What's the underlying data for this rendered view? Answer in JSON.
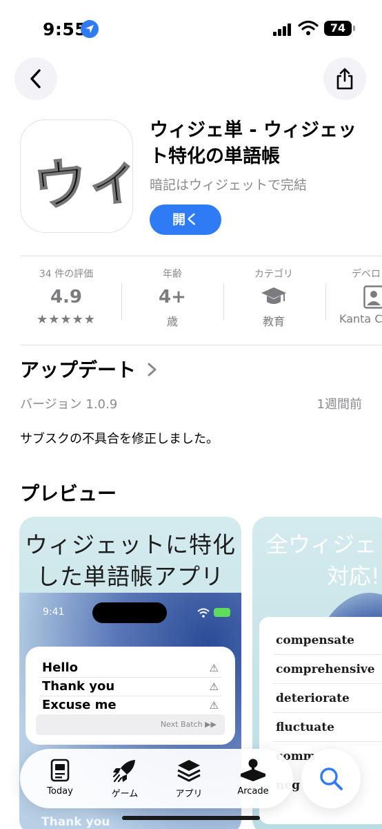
{
  "status_bar": {
    "time": "9:55",
    "battery": "74"
  },
  "app": {
    "title": "ウィジェ単 - ウィジェット特化の単語帳",
    "subtitle": "暗記はウィジェットで完結",
    "open_label": "開く",
    "icon_text": "ウィ"
  },
  "info": {
    "ratings": {
      "label": "34 件の評価",
      "value": "4.9",
      "stars": "★★★★★"
    },
    "age": {
      "label": "年齢",
      "value": "4+",
      "sub": "歳"
    },
    "category": {
      "label": "カテゴリ",
      "sub": "教育"
    },
    "developer": {
      "label": "デベロ",
      "sub": "Kanta C"
    }
  },
  "updates": {
    "title": "アップデート",
    "version": "バージョン 1.0.9",
    "date": "1週間前",
    "notes": "サブスクの不具合を修正しました。"
  },
  "preview": {
    "title": "プレビュー",
    "shot1": {
      "caption_line1": "ウィジェットに特化",
      "caption_line2": "した単語帳アプリ",
      "phone_time": "9:41",
      "words": [
        "Hello",
        "Thank you",
        "Excuse me"
      ],
      "next_label": "Next Batch ▶▶",
      "peek_word": "Thank you"
    },
    "shot2": {
      "caption_line1": "全ウィジェ",
      "caption_line2": "対応!",
      "words": [
        "compensate",
        "comprehensive",
        "deteriorate",
        "fluctuate",
        "comm",
        "neg"
      ]
    }
  },
  "tabs": [
    {
      "label": "Today",
      "icon": "today-icon"
    },
    {
      "label": "ゲーム",
      "icon": "rocket-icon"
    },
    {
      "label": "アプリ",
      "icon": "layers-icon"
    },
    {
      "label": "Arcade",
      "icon": "joystick-icon"
    }
  ],
  "colors": {
    "accent": "#2f7bf5",
    "secondary_text": "#8a8a8e"
  }
}
